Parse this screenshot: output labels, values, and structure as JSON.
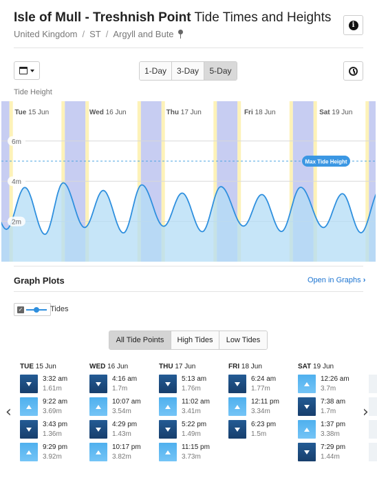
{
  "header": {
    "location": "Isle of Mull - Treshnish Point",
    "title_suffix": " Tide Times and Heights",
    "breadcrumb": [
      "United Kingdom",
      "ST",
      "Argyll and Bute"
    ]
  },
  "toolbar": {
    "day_options": [
      "1-Day",
      "3-Day",
      "5-Day"
    ],
    "selected_days": "5-Day"
  },
  "chart_label": "Tide Height",
  "chart_data": {
    "type": "area",
    "y_ticks": [
      "2m",
      "4m",
      "6m"
    ],
    "ylim": [
      0,
      8
    ],
    "max_line_label": "Max Tide Height",
    "max_line_value": 5,
    "day_labels": [
      {
        "dow": "Tue",
        "date": "15 Jun"
      },
      {
        "dow": "Wed",
        "date": "16 Jun"
      },
      {
        "dow": "Thu",
        "date": "17 Jun"
      },
      {
        "dow": "Fri",
        "date": "18 Jun"
      },
      {
        "dow": "Sat",
        "date": "19 Jun"
      }
    ],
    "tide_points": [
      {
        "day": 0,
        "time": "3:32",
        "h": 1.61
      },
      {
        "day": 0,
        "time": "9:22",
        "h": 3.69
      },
      {
        "day": 0,
        "time": "15:43",
        "h": 1.36
      },
      {
        "day": 0,
        "time": "21:29",
        "h": 3.92
      },
      {
        "day": 1,
        "time": "4:16",
        "h": 1.7
      },
      {
        "day": 1,
        "time": "10:07",
        "h": 3.54
      },
      {
        "day": 1,
        "time": "16:29",
        "h": 1.43
      },
      {
        "day": 1,
        "time": "22:17",
        "h": 3.82
      },
      {
        "day": 2,
        "time": "5:13",
        "h": 1.76
      },
      {
        "day": 2,
        "time": "11:02",
        "h": 3.41
      },
      {
        "day": 2,
        "time": "17:22",
        "h": 1.49
      },
      {
        "day": 2,
        "time": "23:15",
        "h": 3.73
      },
      {
        "day": 3,
        "time": "6:24",
        "h": 1.77
      },
      {
        "day": 3,
        "time": "12:11",
        "h": 3.34
      },
      {
        "day": 3,
        "time": "18:23",
        "h": 1.5
      },
      {
        "day": 4,
        "time": "0:26",
        "h": 3.7
      },
      {
        "day": 4,
        "time": "7:38",
        "h": 1.7
      },
      {
        "day": 4,
        "time": "13:37",
        "h": 3.38
      },
      {
        "day": 4,
        "time": "19:29",
        "h": 1.44
      }
    ]
  },
  "graph_plots": {
    "title": "Graph Plots",
    "open_link": "Open in Graphs",
    "legend_label": "Tides"
  },
  "filters": {
    "options": [
      "All Tide Points",
      "High Tides",
      "Low Tides"
    ],
    "selected": "All Tide Points"
  },
  "days": [
    {
      "dow": "TUE",
      "date": "15 Jun",
      "tides": [
        {
          "type": "low",
          "time": "3:32 am",
          "height": "1.61m"
        },
        {
          "type": "high",
          "time": "9:22 am",
          "height": "3.69m"
        },
        {
          "type": "low",
          "time": "3:43 pm",
          "height": "1.36m"
        },
        {
          "type": "high",
          "time": "9:29 pm",
          "height": "3.92m"
        }
      ]
    },
    {
      "dow": "WED",
      "date": "16 Jun",
      "tides": [
        {
          "type": "low",
          "time": "4:16 am",
          "height": "1.7m"
        },
        {
          "type": "high",
          "time": "10:07 am",
          "height": "3.54m"
        },
        {
          "type": "low",
          "time": "4:29 pm",
          "height": "1.43m"
        },
        {
          "type": "high",
          "time": "10:17 pm",
          "height": "3.82m"
        }
      ]
    },
    {
      "dow": "THU",
      "date": "17 Jun",
      "tides": [
        {
          "type": "low",
          "time": "5:13 am",
          "height": "1.76m"
        },
        {
          "type": "high",
          "time": "11:02 am",
          "height": "3.41m"
        },
        {
          "type": "low",
          "time": "5:22 pm",
          "height": "1.49m"
        },
        {
          "type": "high",
          "time": "11:15 pm",
          "height": "3.73m"
        }
      ]
    },
    {
      "dow": "FRI",
      "date": "18 Jun",
      "tides": [
        {
          "type": "low",
          "time": "6:24 am",
          "height": "1.77m"
        },
        {
          "type": "high",
          "time": "12:11 pm",
          "height": "3.34m"
        },
        {
          "type": "low",
          "time": "6:23 pm",
          "height": "1.5m"
        }
      ]
    },
    {
      "dow": "SAT",
      "date": "19 Jun",
      "tides": [
        {
          "type": "high",
          "time": "12:26 am",
          "height": "3.7m"
        },
        {
          "type": "low",
          "time": "7:38 am",
          "height": "1.7m"
        },
        {
          "type": "high",
          "time": "1:37 pm",
          "height": "3.38m"
        },
        {
          "type": "low",
          "time": "7:29 pm",
          "height": "1.44m"
        }
      ]
    }
  ],
  "colors": {
    "high_arrow": "#5fb8f2",
    "low_arrow": "#1f4f85",
    "link": "#1a73d1",
    "water_fill": "#b3dcf6",
    "tide_line": "#2e8fde",
    "night_band": "#c7cdf2",
    "twilight_band": "#fdf2b8"
  }
}
